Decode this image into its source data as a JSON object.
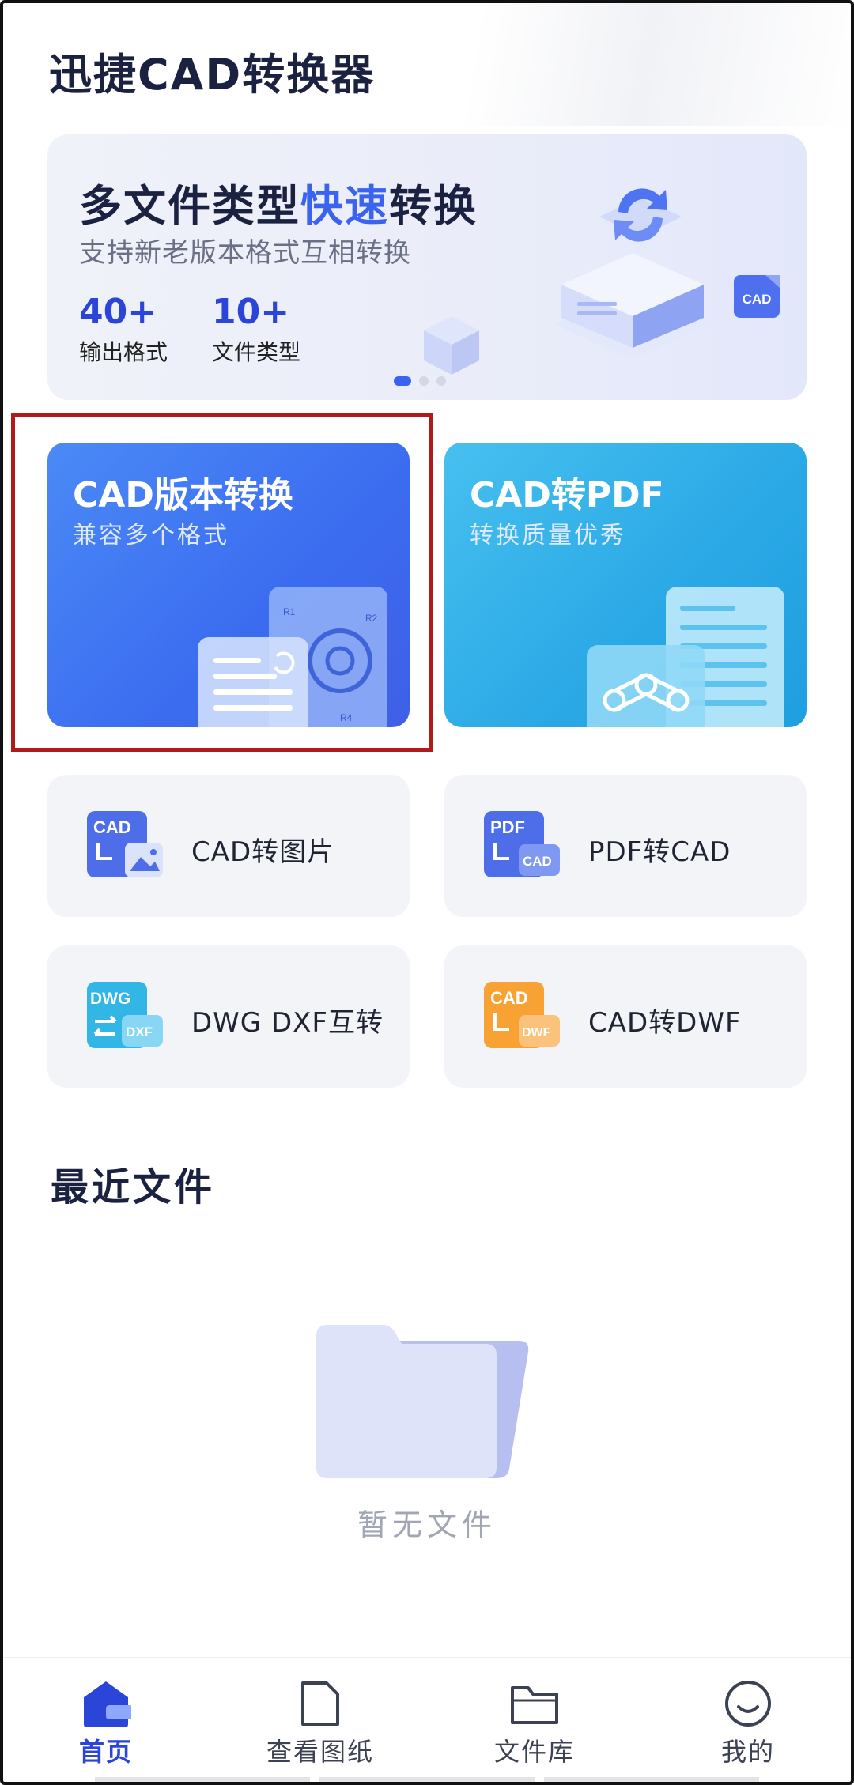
{
  "app": {
    "title": "迅捷CAD转换器"
  },
  "banner": {
    "title_prefix": "多文件类型",
    "title_highlight": "快速",
    "title_suffix": "转换",
    "subtitle": "支持新老版本格式互相转换",
    "stats": [
      {
        "value": "40+",
        "label": "输出格式"
      },
      {
        "value": "10+",
        "label": "文件类型"
      }
    ],
    "badge": "CAD",
    "active_slide": 1,
    "slide_count": 3
  },
  "feature_cards": [
    {
      "title": "CAD版本转换",
      "subtitle": "兼容多个格式",
      "art_labels": [
        "R1",
        "R2",
        "R4"
      ]
    },
    {
      "title": "CAD转PDF",
      "subtitle": "转换质量优秀"
    }
  ],
  "tools": [
    {
      "label": "CAD转图片",
      "icon": "cad-to-image-icon",
      "icon_texts": [
        "CAD"
      ]
    },
    {
      "label": "PDF转CAD",
      "icon": "pdf-to-cad-icon",
      "icon_texts": [
        "PDF",
        "CAD"
      ]
    },
    {
      "label": "DWG DXF互转",
      "icon": "dwg-dxf-convert-icon",
      "icon_texts": [
        "DWG",
        "DXF"
      ]
    },
    {
      "label": "CAD转DWF",
      "icon": "cad-to-dwf-icon",
      "icon_texts": [
        "CAD",
        "DWF"
      ]
    }
  ],
  "recent": {
    "title": "最近文件",
    "empty_text": "暂无文件"
  },
  "nav": {
    "items": [
      {
        "label": "首页",
        "icon": "home-icon",
        "active": true
      },
      {
        "label": "查看图纸",
        "icon": "drawing-icon",
        "active": false
      },
      {
        "label": "文件库",
        "icon": "folder-icon",
        "active": false
      },
      {
        "label": "我的",
        "icon": "profile-icon",
        "active": false
      }
    ]
  },
  "colors": {
    "accent": "#3a63f0",
    "card_blue": "#3b6cf0",
    "card_cyan": "#2aa8e6",
    "highlight_border": "#b01a1a",
    "tool_bg": "#f3f4f8",
    "dwf_orange": "#f7a232"
  }
}
